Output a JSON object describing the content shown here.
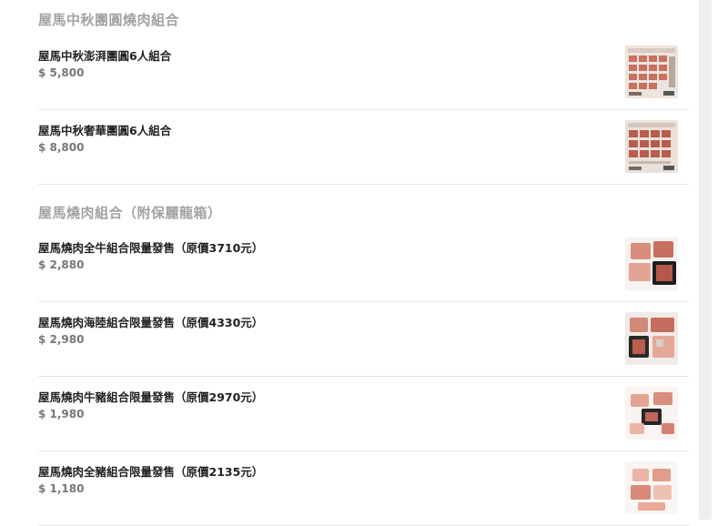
{
  "sections": [
    {
      "title": "屋馬中秋團圓燒肉組合",
      "items": [
        {
          "name": "屋馬中秋澎湃團圓6人組合",
          "price": "$ 5,800",
          "image_icon": "bbq-set-poster-image"
        },
        {
          "name": "屋馬中秋奢華團圓6人組合",
          "price": "$ 8,800",
          "image_icon": "bbq-set-poster-image"
        }
      ]
    },
    {
      "title": "屋馬燒肉組合（附保麗龍箱）",
      "items": [
        {
          "name": "屋馬燒肉全牛組合限量發售（原價3710元）",
          "price": "$ 2,880",
          "image_icon": "meat-tray-photo"
        },
        {
          "name": "屋馬燒肉海陸組合限量發售（原價4330元）",
          "price": "$ 2,980",
          "image_icon": "meat-tray-photo"
        },
        {
          "name": "屋馬燒肉牛豬組合限量發售（原價2970元）",
          "price": "$ 1,980",
          "image_icon": "meat-tray-photo"
        },
        {
          "name": "屋馬燒肉全豬組合限量發售（原價2135元）",
          "price": "$ 1,180",
          "image_icon": "meat-tray-photo"
        }
      ]
    }
  ]
}
